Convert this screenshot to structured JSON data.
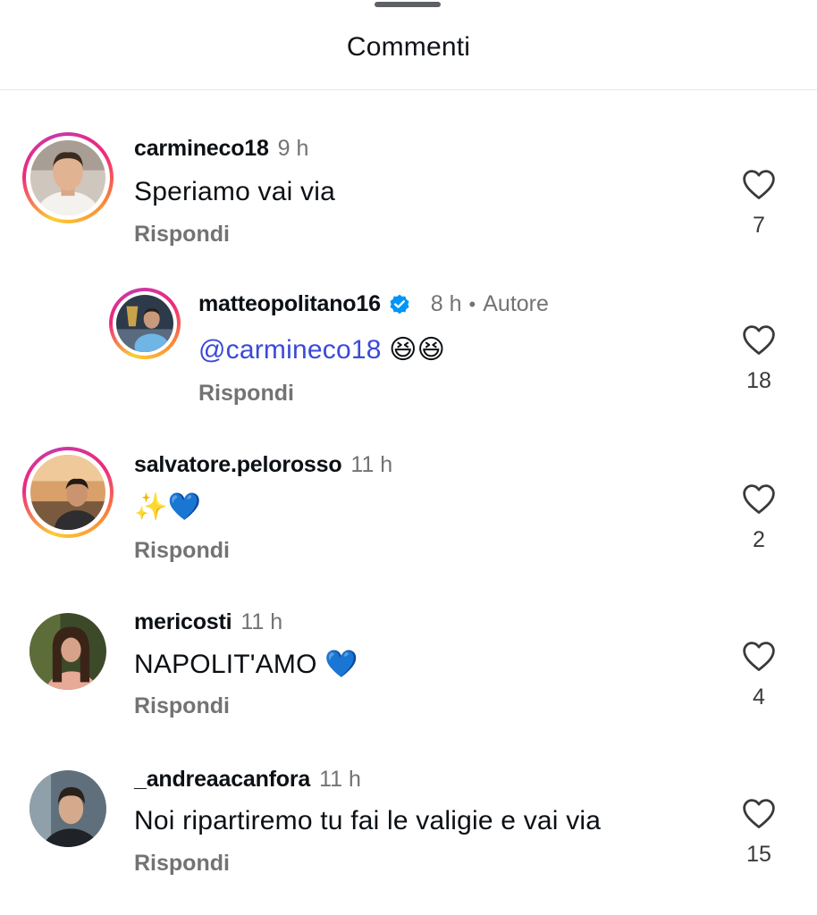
{
  "header": {
    "title": "Commenti"
  },
  "comments": [
    {
      "username": "carmineco18",
      "time": "9 h",
      "text": "Speriamo vai via",
      "reply_label": "Rispondi",
      "likes": "7"
    },
    {
      "username": "matteopolitano16",
      "time": "8 h",
      "dot": "•",
      "author_label": "Autore",
      "mention": "@carmineco18",
      "text_emoji": "😆😆",
      "reply_label": "Rispondi",
      "likes": "18"
    },
    {
      "username": "salvatore.pelorosso",
      "time": "11 h",
      "text": "✨💙",
      "reply_label": "Rispondi",
      "likes": "2"
    },
    {
      "username": "mericosti",
      "time": "11 h",
      "text": "NAPOLIT'AMO 💙",
      "reply_label": "Rispondi",
      "likes": "4"
    },
    {
      "username": "_andreaacanfora",
      "time": "11 h",
      "text": "Noi ripartiremo tu fai le valigie e vai via",
      "reply_label": "Rispondi",
      "likes": "15"
    }
  ],
  "colors": {
    "mention": "#3a4ad8",
    "verified": "#0095f6",
    "secondary_text": "#737373",
    "story_ring": "#ee2a7b"
  },
  "icons": {
    "like": "heart-outline-icon",
    "verified": "verified-badge-icon"
  }
}
